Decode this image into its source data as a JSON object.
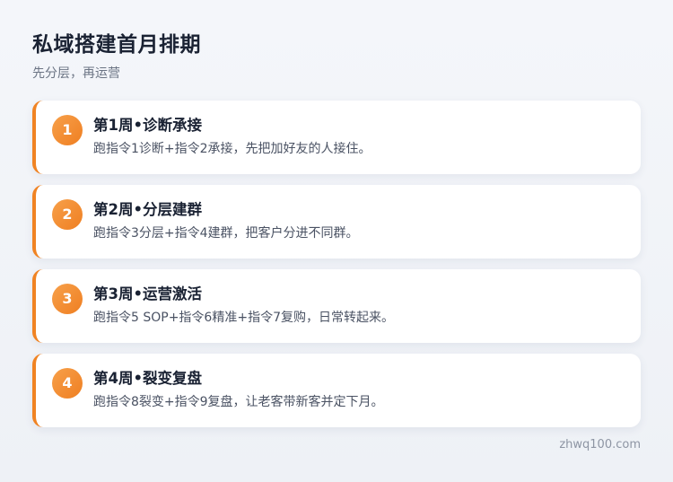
{
  "header": {
    "title": "私域搭建首月排期",
    "subtitle": "先分层，再运营"
  },
  "accent_color": "#f08323",
  "steps": [
    {
      "number": "1",
      "title": "第1周•诊断承接",
      "description": "跑指令1诊断+指令2承接，先把加好友的人接住。"
    },
    {
      "number": "2",
      "title": "第2周•分层建群",
      "description": "跑指令3分层+指令4建群，把客户分进不同群。"
    },
    {
      "number": "3",
      "title": "第3周•运营激活",
      "description": "跑指令5 SOP+指令6精准+指令7复购，日常转起来。"
    },
    {
      "number": "4",
      "title": "第4周•裂变复盘",
      "description": "跑指令8裂变+指令9复盘，让老客带新客并定下月。"
    }
  ],
  "footer": {
    "watermark": "zhwq100.com"
  }
}
